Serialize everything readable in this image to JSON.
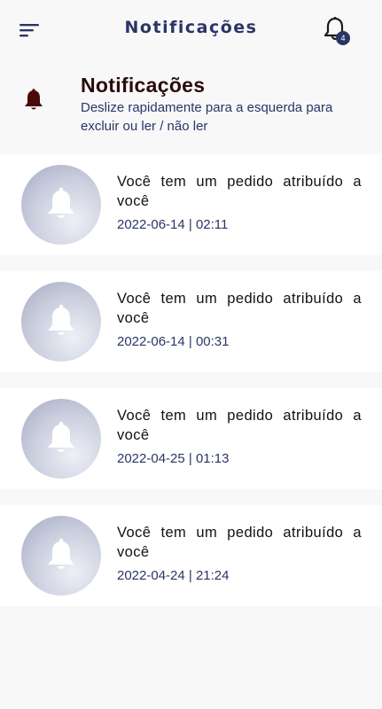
{
  "appbar": {
    "title": "Notificações",
    "badge_count": "4",
    "menu_icon": "menu-icon",
    "bell_icon": "bell-outline-icon"
  },
  "header": {
    "title": "Notificações",
    "subtitle": "Deslize rapidamente para a esquerda para excluir ou ler / não ler",
    "icon": "bell-icon"
  },
  "notifications": [
    {
      "message": "Você tem um pedido atribuído a você",
      "date": "2022-06-14 | 02:11"
    },
    {
      "message": "Você tem um pedido atribuído a você",
      "date": "2022-06-14 | 00:31"
    },
    {
      "message": "Você tem um pedido atribuído a você",
      "date": "2022-04-25 | 01:13"
    },
    {
      "message": "Você tem um pedido atribuído a você",
      "date": "2022-04-24 | 21:24"
    }
  ],
  "colors": {
    "primary": "#2a3566",
    "header_title": "#2b0a0a",
    "header_icon": "#4a0a0a",
    "background": "#f8f8f8",
    "card": "#ffffff"
  }
}
